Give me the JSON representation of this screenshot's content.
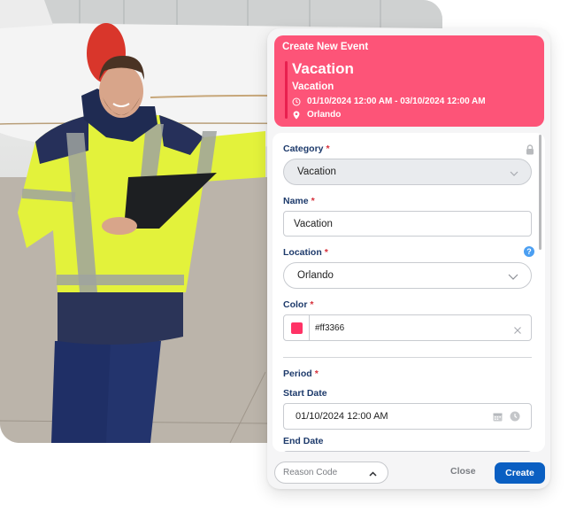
{
  "dialog": {
    "header_title": "Create New Event",
    "event_name": "Vacation",
    "event_category": "Vacation",
    "event_period": "01/10/2024 12:00 AM - 03/10/2024 12:00 AM",
    "event_location": "Orlando",
    "header_color": "#fd5478",
    "header_icons": {
      "time": "clock-icon",
      "location": "map-pin-icon"
    }
  },
  "form": {
    "category": {
      "label": "Category",
      "required_mark": "*",
      "value": "Vacation",
      "locked": true,
      "icon": "lock-icon"
    },
    "name": {
      "label": "Name",
      "required_mark": "*",
      "value": "Vacation"
    },
    "location": {
      "label": "Location",
      "required_mark": "*",
      "value": "Orlando",
      "help_icon": "?"
    },
    "color": {
      "label": "Color",
      "required_mark": "*",
      "value": "#ff3366",
      "swatch": "#ff3366",
      "clear_icon": "close-icon"
    },
    "period": {
      "label": "Period",
      "required_mark": "*",
      "start_label": "Start Date",
      "start_value": "01/10/2024 12:00 AM",
      "end_label": "End Date",
      "end_value": ""
    }
  },
  "footer": {
    "reason_code_placeholder": "Reason Code",
    "close_label": "Close",
    "create_label": "Create",
    "create_color": "#0a5fc2"
  },
  "photo": {
    "description": "Smiling worker in hi-vis jacket holding a clipboard in an aircraft hangar"
  }
}
